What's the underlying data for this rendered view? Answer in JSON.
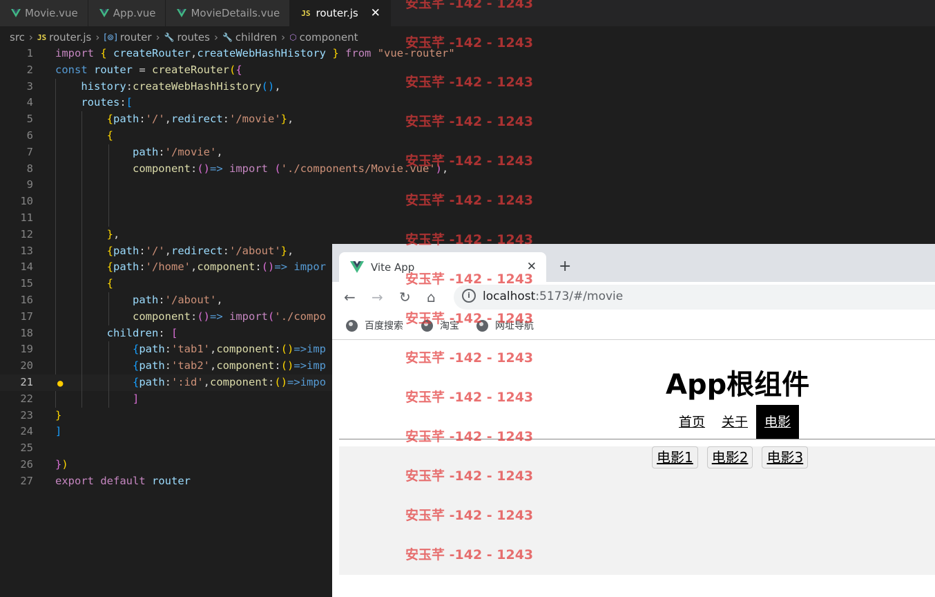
{
  "editor": {
    "tabs": [
      {
        "label": "Movie.vue",
        "type": "vue"
      },
      {
        "label": "App.vue",
        "type": "vue"
      },
      {
        "label": "MovieDetails.vue",
        "type": "vue"
      },
      {
        "label": "router.js",
        "type": "js",
        "active": true
      }
    ],
    "js_badge": "JS",
    "close_glyph": "✕",
    "breadcrumb": [
      "src",
      "router.js",
      "router",
      "routes",
      "children",
      "component"
    ],
    "line_numbers": [
      "1",
      "2",
      "3",
      "4",
      "5",
      "6",
      "7",
      "8",
      "9",
      "10",
      "11",
      "12",
      "13",
      "14",
      "15",
      "16",
      "17",
      "18",
      "19",
      "20",
      "21",
      "22",
      "23",
      "24",
      "25",
      "26",
      "27"
    ],
    "active_line": 21
  },
  "browser": {
    "tab_title": "Vite App",
    "url_host": "localhost",
    "url_rest": ":5173/#/movie",
    "bookmarks": [
      "百度搜索",
      "淘宝",
      "网址导航"
    ],
    "page": {
      "title": "App根组件",
      "nav": [
        "首页",
        "关于",
        "电影"
      ],
      "active_nav": "电影",
      "movies": [
        "电影1",
        "电影2",
        "电影3"
      ]
    }
  },
  "watermark": "安玉芊 -142 - 1243",
  "icons": {
    "vue": "vue-logo-icon",
    "back": "back-arrow-icon",
    "forward": "forward-arrow-icon",
    "reload": "reload-icon",
    "home": "home-icon",
    "info": "info-icon",
    "globe": "globe-icon",
    "bulb": "lightbulb-icon"
  },
  "colors": {
    "editor_bg": "#1e1e1e",
    "keyword": "#c586c0",
    "string": "#ce9178",
    "variable": "#9cdcfe",
    "function": "#dcdcaa",
    "watermark": "#e23a3a"
  }
}
